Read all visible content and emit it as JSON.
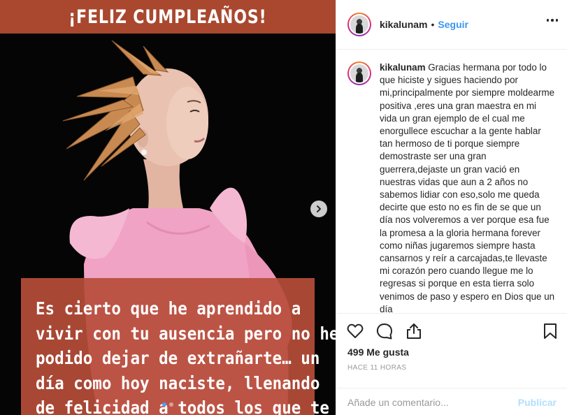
{
  "post": {
    "banner_text": "¡FELIZ CUMPLEAÑOS!",
    "overlay_lines": [
      "Es cierto que he aprendido a",
      "vivir con tu ausencia pero no he",
      "podido dejar de extrañarte… un",
      "día como hoy naciste, llenando",
      "de felicidad a todos los que te"
    ],
    "carousel_count": 2,
    "carousel_active": 1,
    "colors": {
      "banner": "#a9482f",
      "overlay": "#b74d3a",
      "background": "#050505",
      "dress": "#f0a3c4",
      "crown": "#c98a52"
    }
  },
  "header": {
    "username": "kikalunam",
    "separator": "•",
    "follow_label": "Seguir",
    "more_icon": "ellipsis-icon"
  },
  "caption": {
    "username": "kikalunam",
    "text": "Gracias hermana por todo lo que hiciste y sigues haciendo por mi,principalmente por siempre moldearme positiva ,eres una gran maestra en mi vida un gran ejemplo de el cual me enorgullece escuchar a la gente hablar tan hermoso de ti porque siempre demostraste ser una gran guerrera,dejaste un gran vació en nuestras vidas que aun a 2 años no sabemos lidiar con eso,solo me queda decirte que esto no es fin de se que un día nos volveremos a ver porque esa fue la promesa a la gloria hermana forever como niñas jugaremos siempre hasta cansarnos y reír a carcajadas,te llevaste mi corazón pero cuando llegue me lo regresas si porque en esta tierra solo venimos de paso y espero en Dios que un día"
  },
  "actions": {
    "icons": [
      "heart-icon",
      "comment-icon",
      "share-icon",
      "bookmark-icon"
    ],
    "likes_label": "499 Me gusta",
    "timestamp": "HACE 11 HORAS"
  },
  "comment_box": {
    "placeholder": "Añade un comentario...",
    "publish_label": "Publicar",
    "publish_color": "#b2dffc"
  },
  "accent": "#3897f0"
}
